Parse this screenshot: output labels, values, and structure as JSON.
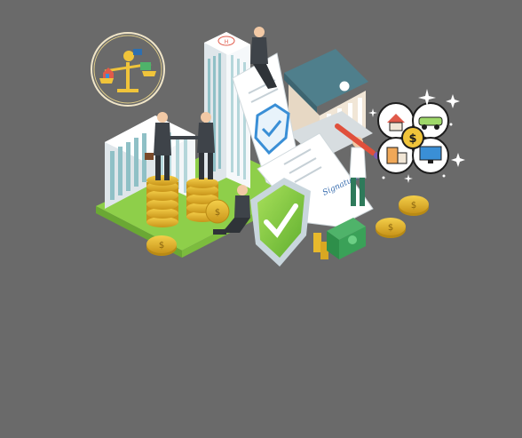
{
  "scene": {
    "signature_text": "Signature",
    "coin_symbol": "$",
    "building_sign": "H"
  },
  "colors": {
    "background": "#6a6a6a",
    "platform_green": "#8ecf4a",
    "building_white": "#eef2f4",
    "building_window": "#8fc0c6",
    "bank_roof": "#4f7f8c",
    "coin_gold": "#e8b92c",
    "coin_dark": "#b98a14",
    "shield_green": "#8ccf3f",
    "shield_border": "#c9d6dd",
    "document_paper": "#ffffff",
    "cash_green": "#2e8f4a",
    "badge_check_blue": "#3a8fd6",
    "suit_dark": "#3e4349"
  },
  "icons": {
    "scale_badge": "balance-scale-assets-icon",
    "asset_cluster": "asset-cluster-house-car-building-computer-icon",
    "shield": "shield-check-icon",
    "document": "contract-document-icon"
  }
}
